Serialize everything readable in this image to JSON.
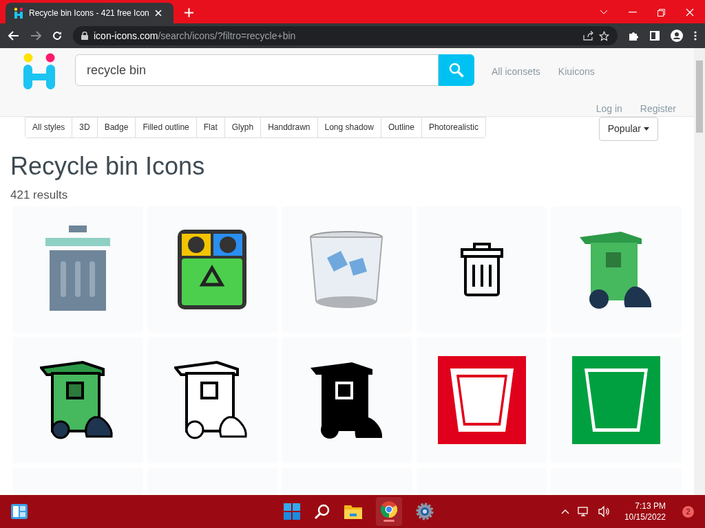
{
  "browser": {
    "tab_title": "Recycle bin Icons - 421 free Icon",
    "url_host": "icon-icons.com",
    "url_path": "/search/icons/?filtro=recycle+bin"
  },
  "header": {
    "search_value": "recycle bin",
    "links": [
      "All iconsets",
      "Kiuicons"
    ],
    "account_links": [
      "Log in",
      "Register"
    ]
  },
  "filters": [
    {
      "label": "All styles"
    },
    {
      "label": "3D"
    },
    {
      "label": "Badge"
    },
    {
      "label": "Filled outline"
    },
    {
      "label": "Flat"
    },
    {
      "label": "Glyph"
    },
    {
      "label": "Handdrawn"
    },
    {
      "label": "Long shadow"
    },
    {
      "label": "Outline"
    },
    {
      "label": "Photorealistic"
    }
  ],
  "sort": "Popular",
  "title": "Recycle bin Icons",
  "count": "421 results",
  "results": [
    {
      "kind": "flat-bin"
    },
    {
      "kind": "recycle-station"
    },
    {
      "kind": "glass-bin"
    },
    {
      "kind": "outline-bin"
    },
    {
      "kind": "green-cart"
    },
    {
      "kind": "green-cart-outline"
    },
    {
      "kind": "cart-outline"
    },
    {
      "kind": "cart-glyph"
    },
    {
      "kind": "red-square"
    },
    {
      "kind": "green-square"
    },
    {
      "kind": "partial"
    },
    {
      "kind": "partial"
    },
    {
      "kind": "partial"
    },
    {
      "kind": "partial"
    },
    {
      "kind": "partial"
    }
  ],
  "taskbar": {
    "time": "7:13 PM",
    "date": "10/15/2022",
    "notifications": "2"
  }
}
